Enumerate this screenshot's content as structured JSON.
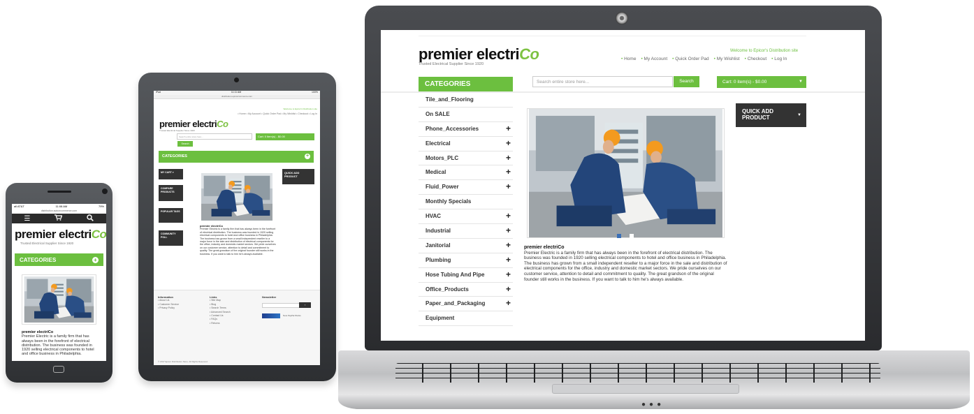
{
  "brand": {
    "logo_main": "premier electri",
    "logo_co": "Co",
    "tagline": "Trusted Electrical Supplier Since 1920"
  },
  "laptop": {
    "welcome": "Welcome to Epicor's Distribution site",
    "nav": [
      "Home",
      "My Account",
      "Quick Order Pad",
      "My Wishlist",
      "Checkout",
      "Log In"
    ],
    "categories_title": "CATEGORIES",
    "search_placeholder": "Search entire store here...",
    "search_button": "Search",
    "cart_label": "Cart:",
    "cart_value": "0 item(s) - $0.00",
    "categories": [
      {
        "label": "Tile_and_Flooring",
        "expandable": false
      },
      {
        "label": "On SALE",
        "expandable": false
      },
      {
        "label": "Phone_Accessories",
        "expandable": true
      },
      {
        "label": "Electrical",
        "expandable": true
      },
      {
        "label": "Motors_PLC",
        "expandable": true
      },
      {
        "label": "Medical",
        "expandable": true
      },
      {
        "label": "Fluid_Power",
        "expandable": true
      },
      {
        "label": "Monthly Specials",
        "expandable": false
      },
      {
        "label": "HVAC",
        "expandable": true
      },
      {
        "label": "Industrial",
        "expandable": true
      },
      {
        "label": "Janitorial",
        "expandable": true
      },
      {
        "label": "Plumbing",
        "expandable": true
      },
      {
        "label": "Hose Tubing And Pipe",
        "expandable": true
      },
      {
        "label": "Office_Products",
        "expandable": true
      },
      {
        "label": "Paper_and_Packaging",
        "expandable": true
      },
      {
        "label": "Equipment",
        "expandable": false
      }
    ],
    "quick_add": "QUICK ADD PRODUCT",
    "about_title": "premier electriCo",
    "about_body": "Premier Electric is a family firm that has always been in the forefront of electrical distribution. The business was founded in 1920 selling electrical components to hotel and office business in Philadelphia. The business has grown from a small independent reseller to a major force in the sale and distribution of electrical components for the office, industry and domestic market sectors. We pride ourselves on our customer service, attention to detail and commitment to quality. The great grandson of the original founder still works in the business. If you want to talk to him he's always available."
  },
  "tablet": {
    "status_left": "iPad",
    "status_time": "11:11 AM",
    "status_right": "100%",
    "url": "distribution.epicorcommerce.com",
    "welcome": "Welcome to Epicor's Distribution site",
    "nav": "• Home • My Account • Quick Order Pad • My Wishlist • Checkout • Log In",
    "search_placeholder": "Search entire store here...",
    "search_button": "Search",
    "cart": "Cart: 0 item(s) - $0.00",
    "categories_title": "CATEGORIES",
    "side_buttons": [
      "MY CART",
      "COMPARE PRODUCTS",
      "POPULAR TAGS",
      "COMMUNITY POLL"
    ],
    "quick_add": "QUICK ADD PRODUCT",
    "about_title": "premier electriCo",
    "about_body": "Premier Electric is a family firm that has always been in the forefront of electrical distribution. The business was founded in 1920 selling electrical components to hotel and office business in Philadelphia. The business has grown from a small independent reseller to a major force in the sale and distribution of electrical components for the office, industry and domestic market sectors. We pride ourselves on our customer service, attention to detail and commitment to quality. The great grandson of the original founder still works in the business. If you want to talk to him he's always available.",
    "footer": {
      "information_title": "Information",
      "information": [
        "About Us",
        "Customer Service",
        "Privacy Policy"
      ],
      "links_title": "Links",
      "links": [
        "Site Map",
        "Blog",
        "Search Terms",
        "Advanced Search",
        "Contact Us",
        "FAQs",
        "Returns"
      ],
      "newsletter_title": "Newsletter",
      "newsletter_button": "›",
      "paypal_text": "Now PayPal Works",
      "copyright": "© 2017 Epicor Distribution Store. All Rights Reserved."
    }
  },
  "phone": {
    "status_left": "all AT&T",
    "status_time": "11:08 AM",
    "status_right": "79%",
    "url": "distribution.epicorcommerce.com",
    "categories_title": "CATEGORIES",
    "about_title": "premier electriCo",
    "about_body": "Premier Electric is a family firm that has always been in the forefront of electrical distribution. The business was founded in 1920 selling electrical components to hotel and office business in Philadelphia."
  },
  "colors": {
    "accent_green": "#6cbf3f",
    "dark_button": "#333333"
  },
  "icons": [
    "menu-icon",
    "cart-icon",
    "search-icon",
    "plus-icon",
    "caret-down-icon",
    "camera-icon"
  ]
}
